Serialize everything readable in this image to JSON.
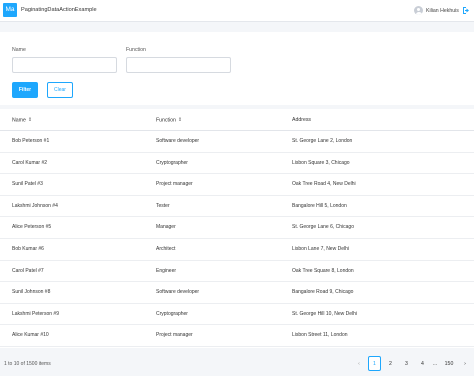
{
  "app": {
    "logo_text": "Ma",
    "title": "PaginatingDataActionExample"
  },
  "user": {
    "name": "Kilian Hekhuis"
  },
  "filter": {
    "name_label": "Name",
    "function_label": "Function",
    "name_value": "",
    "function_value": "",
    "filter_button": "Filter",
    "clear_button": "Clear"
  },
  "table": {
    "columns": [
      "Name",
      "Function",
      "Address"
    ],
    "rows": [
      [
        "Bob Peterson #1",
        "Software developer",
        "St. George Lane 2, London"
      ],
      [
        "Carol Kumar #2",
        "Cryptographer",
        "Lisbon Square 3, Chicago"
      ],
      [
        "Sunil Patel #3",
        "Project manager",
        "Oak Tree Road 4, New Delhi"
      ],
      [
        "Lakshmi Johnson #4",
        "Tester",
        "Bangalore Hill 5, London"
      ],
      [
        "Alice Peterson #5",
        "Manager",
        "St. George Lane 6, Chicago"
      ],
      [
        "Bob Kumar #6",
        "Architect",
        "Lisbon Lane 7, New Delhi"
      ],
      [
        "Carol Patel #7",
        "Engineer",
        "Oak Tree Square 8, London"
      ],
      [
        "Sunil Johnson #8",
        "Software developer",
        "Bangalore Road 9, Chicago"
      ],
      [
        "Lakshmi Peterson #9",
        "Cryptographer",
        "St. George Hill 10, New Delhi"
      ],
      [
        "Alice Kumar #10",
        "Project manager",
        "Lisbon Street 11, London"
      ]
    ]
  },
  "pagination": {
    "summary": "1 to 10 of 1500 items",
    "prev": "‹",
    "pages": [
      "1",
      "2",
      "3",
      "4",
      "...",
      "150"
    ],
    "next": "›",
    "current": "1"
  },
  "colors": {
    "accent": "#1ea7fd",
    "background": "#f4f6f9"
  },
  "icons": {
    "logout": "logout-icon",
    "user": "user-avatar-icon",
    "sort": "sort-icon"
  }
}
